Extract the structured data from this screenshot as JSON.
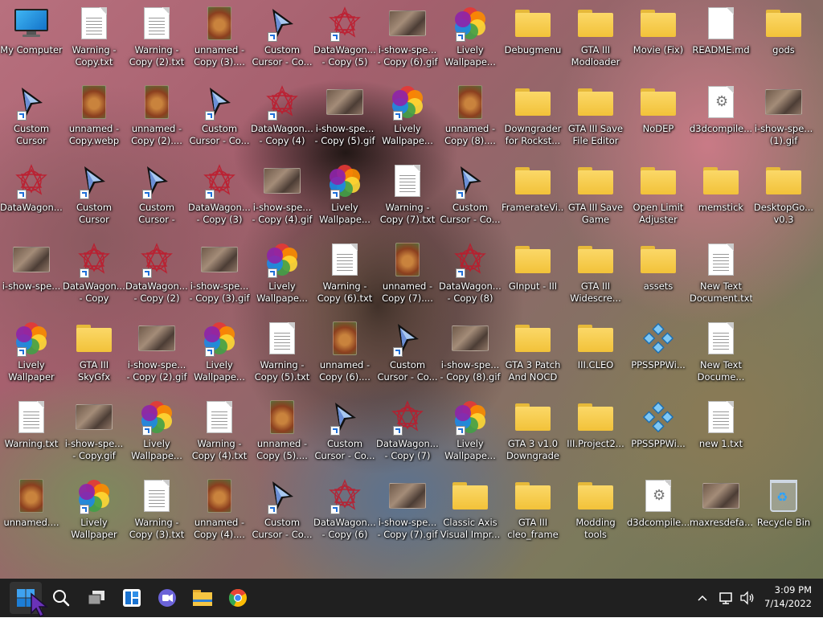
{
  "desktop": {
    "icons": [
      {
        "label": "My Computer",
        "type": "computer",
        "shortcut": false
      },
      {
        "label": "Warning -\nCopy.txt",
        "type": "doc",
        "shortcut": false
      },
      {
        "label": "Warning -\nCopy (2).txt",
        "type": "doc",
        "shortcut": false
      },
      {
        "label": "unnamed -\nCopy (3)....",
        "type": "thumb-tall",
        "shortcut": false
      },
      {
        "label": "Custom\nCursor - Co...",
        "type": "cursor",
        "shortcut": true
      },
      {
        "label": "DataWagon....\n- Copy (5)",
        "type": "datawagon",
        "shortcut": true
      },
      {
        "label": "i-show-spe...\n- Copy (6).gif",
        "type": "thumb",
        "shortcut": false
      },
      {
        "label": "Lively\nWallpape...",
        "type": "lively",
        "shortcut": true
      },
      {
        "label": "Debugmenu",
        "type": "folder",
        "shortcut": false
      },
      {
        "label": "GTA III\nModloader",
        "type": "folder",
        "shortcut": false
      },
      {
        "label": "Movie (Fix)",
        "type": "folder",
        "shortcut": false
      },
      {
        "label": "README.md",
        "type": "doc-blank",
        "shortcut": false
      },
      {
        "label": "gods",
        "type": "folder",
        "shortcut": false
      },
      {
        "label": "Custom\nCursor",
        "type": "cursor",
        "shortcut": true
      },
      {
        "label": "unnamed -\nCopy.webp",
        "type": "thumb-tall",
        "shortcut": false
      },
      {
        "label": "unnamed -\nCopy (2)....",
        "type": "thumb-tall",
        "shortcut": false
      },
      {
        "label": "Custom\nCursor - Co...",
        "type": "cursor",
        "shortcut": true
      },
      {
        "label": "DataWagon....\n- Copy (4)",
        "type": "datawagon",
        "shortcut": true
      },
      {
        "label": "i-show-spe...\n- Copy (5).gif",
        "type": "thumb",
        "shortcut": false
      },
      {
        "label": "Lively\nWallpape...",
        "type": "lively",
        "shortcut": true
      },
      {
        "label": "unnamed -\nCopy (8)....",
        "type": "thumb-tall",
        "shortcut": false
      },
      {
        "label": "Downgrader\nfor Rockst...",
        "type": "folder",
        "shortcut": false
      },
      {
        "label": "GTA III Save\nFile Editor",
        "type": "folder",
        "shortcut": false
      },
      {
        "label": "NoDEP",
        "type": "folder",
        "shortcut": false
      },
      {
        "label": "d3dcompile...",
        "type": "gear",
        "shortcut": false
      },
      {
        "label": "i-show-spe...\n(1).gif",
        "type": "thumb",
        "shortcut": false
      },
      {
        "label": "DataWagon....",
        "type": "datawagon",
        "shortcut": true
      },
      {
        "label": "Custom\nCursor",
        "type": "cursor",
        "shortcut": true
      },
      {
        "label": "Custom\nCursor - Copy",
        "type": "cursor",
        "shortcut": true
      },
      {
        "label": "DataWagon....\n- Copy (3)",
        "type": "datawagon",
        "shortcut": true
      },
      {
        "label": "i-show-spe...\n- Copy (4).gif",
        "type": "thumb",
        "shortcut": false
      },
      {
        "label": "Lively\nWallpape...",
        "type": "lively",
        "shortcut": true
      },
      {
        "label": "Warning -\nCopy (7).txt",
        "type": "doc",
        "shortcut": false
      },
      {
        "label": "Custom\nCursor - Co...",
        "type": "cursor",
        "shortcut": true
      },
      {
        "label": "FramerateVi...",
        "type": "folder",
        "shortcut": false
      },
      {
        "label": "GTA III Save\nGame",
        "type": "folder",
        "shortcut": false
      },
      {
        "label": "Open Limit\nAdjuster",
        "type": "folder",
        "shortcut": false
      },
      {
        "label": "memstick",
        "type": "folder",
        "shortcut": false
      },
      {
        "label": "DesktopGo...\nv0.3",
        "type": "folder",
        "shortcut": false
      },
      {
        "label": "i-show-spe...",
        "type": "thumb",
        "shortcut": false
      },
      {
        "label": "DataWagon....\n- Copy",
        "type": "datawagon",
        "shortcut": true
      },
      {
        "label": "DataWagon....\n- Copy (2)",
        "type": "datawagon",
        "shortcut": true
      },
      {
        "label": "i-show-spe...\n- Copy (3).gif",
        "type": "thumb",
        "shortcut": false
      },
      {
        "label": "Lively\nWallpape...",
        "type": "lively",
        "shortcut": true
      },
      {
        "label": "Warning -\nCopy (6).txt",
        "type": "doc",
        "shortcut": false
      },
      {
        "label": "unnamed -\nCopy (7)....",
        "type": "thumb-tall",
        "shortcut": false
      },
      {
        "label": "DataWagon....\n- Copy (8)",
        "type": "datawagon",
        "shortcut": true
      },
      {
        "label": "GInput - III",
        "type": "folder",
        "shortcut": false
      },
      {
        "label": "GTA III\nWidescre...",
        "type": "folder",
        "shortcut": false
      },
      {
        "label": "assets",
        "type": "folder",
        "shortcut": false
      },
      {
        "label": "New Text\nDocument.txt",
        "type": "doc",
        "shortcut": false
      },
      {
        "label": "Lively\nWallpaper",
        "type": "lively",
        "shortcut": true
      },
      {
        "label": "GTA III SkyGfx",
        "type": "folder",
        "shortcut": false
      },
      {
        "label": "i-show-spe...\n- Copy (2).gif",
        "type": "thumb",
        "shortcut": false
      },
      {
        "label": "Lively\nWallpape...",
        "type": "lively",
        "shortcut": true
      },
      {
        "label": "Warning -\nCopy (5).txt",
        "type": "doc",
        "shortcut": false
      },
      {
        "label": "unnamed -\nCopy (6)....",
        "type": "thumb-tall",
        "shortcut": false
      },
      {
        "label": "Custom\nCursor - Co...",
        "type": "cursor",
        "shortcut": true
      },
      {
        "label": "i-show-spe...\n- Copy (8).gif",
        "type": "thumb",
        "shortcut": false
      },
      {
        "label": "GTA 3 Patch\nAnd NOCD",
        "type": "folder",
        "shortcut": false
      },
      {
        "label": "III.CLEO",
        "type": "folder",
        "shortcut": false
      },
      {
        "label": "PPSSPPWi...",
        "type": "ppsspp",
        "shortcut": false
      },
      {
        "label": "New Text\nDocume...",
        "type": "doc",
        "shortcut": false
      },
      {
        "label": "Warning.txt",
        "type": "doc",
        "shortcut": false
      },
      {
        "label": "i-show-spe...\n- Copy.gif",
        "type": "thumb",
        "shortcut": false
      },
      {
        "label": "Lively\nWallpape...",
        "type": "lively",
        "shortcut": true
      },
      {
        "label": "Warning -\nCopy (4).txt",
        "type": "doc",
        "shortcut": false
      },
      {
        "label": "unnamed -\nCopy (5)....",
        "type": "thumb-tall",
        "shortcut": false
      },
      {
        "label": "Custom\nCursor - Co...",
        "type": "cursor",
        "shortcut": true
      },
      {
        "label": "DataWagon....\n- Copy (7)",
        "type": "datawagon",
        "shortcut": true
      },
      {
        "label": "Lively\nWallpape...",
        "type": "lively",
        "shortcut": true
      },
      {
        "label": "GTA 3 v1.0\nDowngrade",
        "type": "folder",
        "shortcut": false
      },
      {
        "label": "III.Project2...",
        "type": "folder",
        "shortcut": false
      },
      {
        "label": "PPSSPPWi...",
        "type": "ppsspp",
        "shortcut": false
      },
      {
        "label": "new 1.txt",
        "type": "doc",
        "shortcut": false
      },
      {
        "label": "unnamed....",
        "type": "thumb-tall",
        "shortcut": false
      },
      {
        "label": "Lively\nWallpaper",
        "type": "lively",
        "shortcut": true
      },
      {
        "label": "Warning -\nCopy (3).txt",
        "type": "doc",
        "shortcut": false
      },
      {
        "label": "unnamed -\nCopy (4)....",
        "type": "thumb-tall",
        "shortcut": false
      },
      {
        "label": "Custom\nCursor - Co...",
        "type": "cursor",
        "shortcut": true
      },
      {
        "label": "DataWagon....\n- Copy (6)",
        "type": "datawagon",
        "shortcut": true
      },
      {
        "label": "i-show-spe...\n- Copy (7).gif",
        "type": "thumb",
        "shortcut": false
      },
      {
        "label": "Classic Axis\nVisual Impr...",
        "type": "folder",
        "shortcut": false
      },
      {
        "label": "GTA III\ncleo_frame ...",
        "type": "folder",
        "shortcut": false
      },
      {
        "label": "Modding\ntools",
        "type": "folder",
        "shortcut": false
      },
      {
        "label": "d3dcompile...",
        "type": "gear",
        "shortcut": false
      },
      {
        "label": "maxresdefa...",
        "type": "thumb",
        "shortcut": false
      },
      {
        "label": "Recycle Bin",
        "type": "bin",
        "shortcut": false
      }
    ]
  },
  "taskbar": {
    "buttons": [
      {
        "name": "start-button",
        "icon": "windows-logo-icon"
      },
      {
        "name": "search-button",
        "icon": "search-icon"
      },
      {
        "name": "task-view-button",
        "icon": "task-view-icon"
      },
      {
        "name": "widgets-button",
        "icon": "widgets-icon"
      },
      {
        "name": "chat-button",
        "icon": "teams-chat-icon"
      },
      {
        "name": "file-explorer-button",
        "icon": "folder-icon"
      },
      {
        "name": "chrome-button",
        "icon": "chrome-icon"
      }
    ],
    "clock": {
      "time": "3:09 PM",
      "date": "7/14/2022"
    },
    "colors": {
      "background": "#202020",
      "accent": "#3d8bdf"
    }
  }
}
